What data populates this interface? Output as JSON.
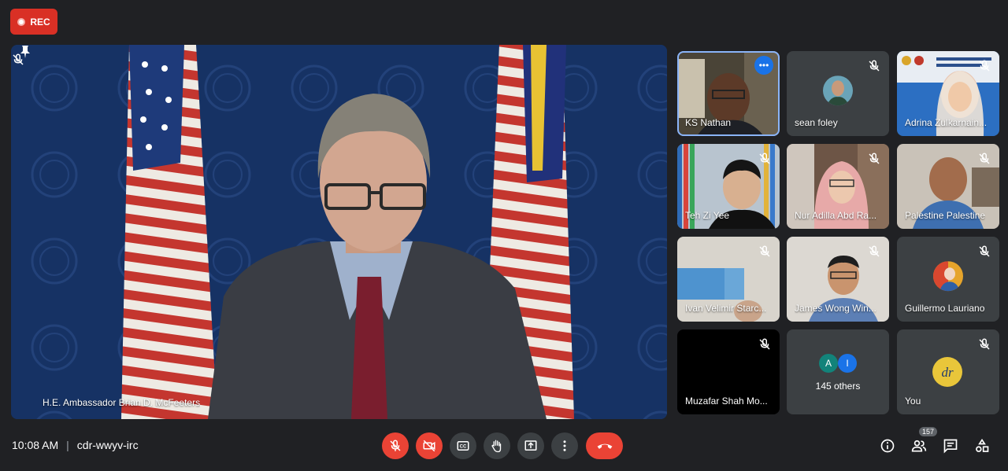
{
  "recording": {
    "label": "REC"
  },
  "presenter": {
    "name": "H.E. Ambassador Brian D. McFeeters"
  },
  "participants": [
    {
      "name": "KS Nathan"
    },
    {
      "name": "sean foley"
    },
    {
      "name": "Adrina Zulkarnain..."
    },
    {
      "name": "Teh Zi Yee"
    },
    {
      "name": "Nur Adilla Abd Ra..."
    },
    {
      "name": "Palestine Palestine"
    },
    {
      "name": "Ivan Velimir Starc..."
    },
    {
      "name": "James Wong Win..."
    },
    {
      "name": "Guillermo Lauriano"
    },
    {
      "name": "Muzafar Shah Mo..."
    },
    {
      "name": "145 others",
      "avatars": [
        "A",
        "I"
      ]
    },
    {
      "name": "You"
    }
  ],
  "meeting": {
    "time": "10:08 AM",
    "separator": "|",
    "code": "cdr-wwyv-irc"
  },
  "people_count": "157",
  "colors": {
    "record": "#d93025",
    "danger": "#ea4335",
    "active_border": "#8ab4f8",
    "tile": "#3c4043",
    "background": "#202124"
  }
}
